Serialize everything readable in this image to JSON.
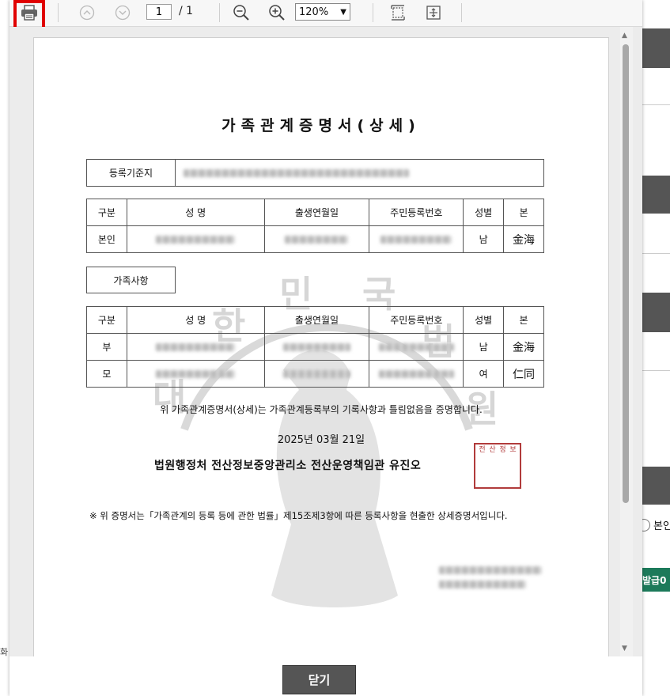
{
  "toolbar": {
    "page_current": "1",
    "page_separator": "/ 1",
    "zoom_value": "120%"
  },
  "document": {
    "title": "가족관계증명서(상세)",
    "registry_label": "등록기준지",
    "headers": {
      "category": "구분",
      "name": "성     명",
      "birth": "출생연월일",
      "rrn": "주민등록번호",
      "gender": "성별",
      "origin": "본"
    },
    "self_row": {
      "category": "본인",
      "gender": "남",
      "origin": "金海"
    },
    "family_label": "가족사항",
    "family_rows": [
      {
        "category": "부",
        "gender": "남",
        "origin": "金海"
      },
      {
        "category": "모",
        "gender": "여",
        "origin": "仁同"
      }
    ],
    "certify_text": "위 가족관계증명서(상세)는 가족관계등록부의 기록사항과 틀림없음을 증명합니다.",
    "date": "2025년 03월 21일",
    "issuer": "법원행정처 전산정보중앙관리소 전산운영책임관 유진오",
    "seal_chars": [
      "전",
      "산",
      "정",
      "보"
    ],
    "note": "※ 위 증명서는「가족관계의 등록 등에 관한 법률」제15조제3항에 따른 등록사항을 현출한 상세증명서입니다."
  },
  "footer": {
    "close_label": "닫기"
  },
  "background": {
    "radio_fragment": "본인",
    "button_fragment": "발급0"
  }
}
